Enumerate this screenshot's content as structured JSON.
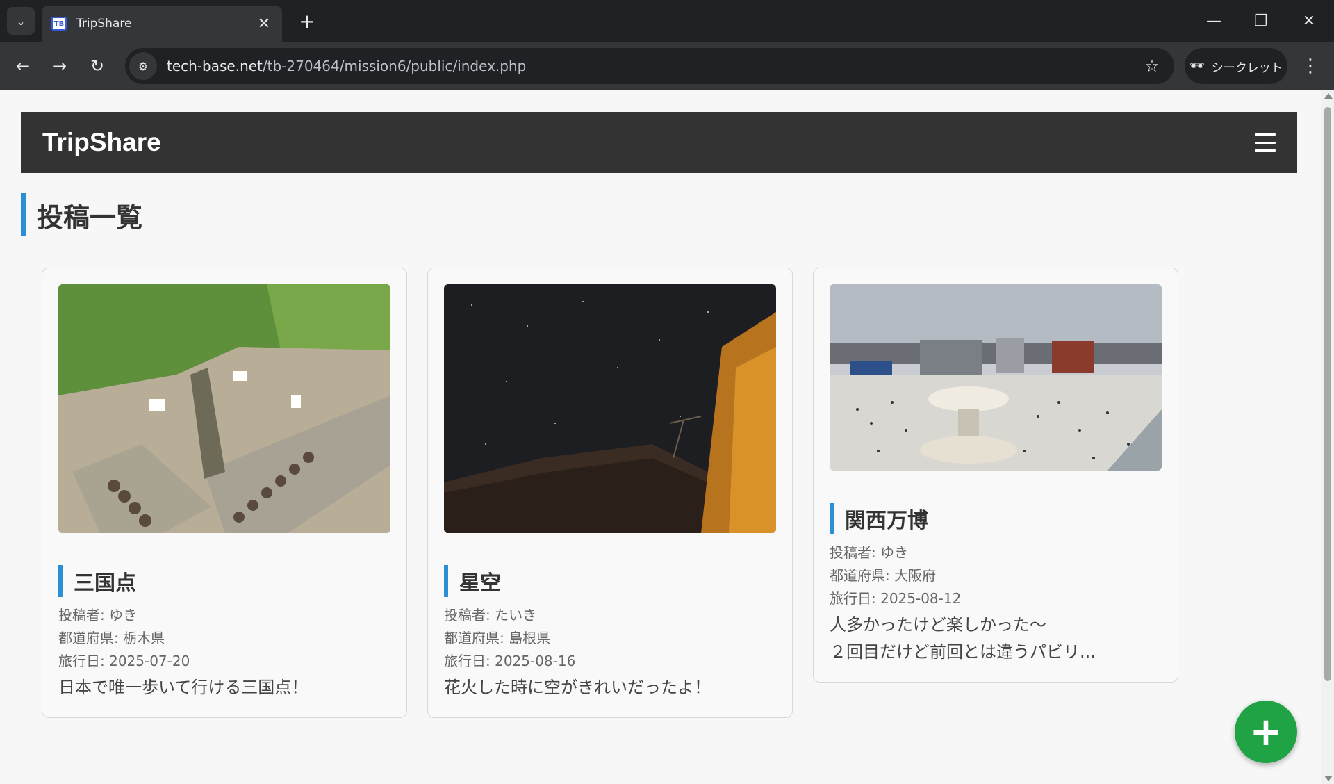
{
  "browser": {
    "tab_title": "TripShare",
    "favicon_text": "TB",
    "url_host": "tech-base.net",
    "url_path": "/tb-270464/mission6/public/index.php",
    "incognito_label": "シークレット"
  },
  "app": {
    "brand": "TripShare",
    "page_title": "投稿一覧",
    "accent_color": "#2b8fd6",
    "fab_color": "#1fa344",
    "fab_label": "+"
  },
  "posts": [
    {
      "title": "三国点",
      "author": "投稿者: ゆき",
      "prefecture": "都道府県: 栃木県",
      "date": "旅行日: 2025-07-20",
      "description": "日本で唯一歩いて行ける三国点！"
    },
    {
      "title": "星空",
      "author": "投稿者: たいき",
      "prefecture": "都道府県: 島根県",
      "date": "旅行日: 2025-08-16",
      "description": "花火した時に空がきれいだったよ！"
    },
    {
      "title": "関西万博",
      "author": "投稿者: ゆき",
      "prefecture": "都道府県: 大阪府",
      "date": "旅行日: 2025-08-12",
      "description": "人多かったけど楽しかった〜",
      "description_2": "２回目だけど前回とは違うパビリ..."
    }
  ]
}
